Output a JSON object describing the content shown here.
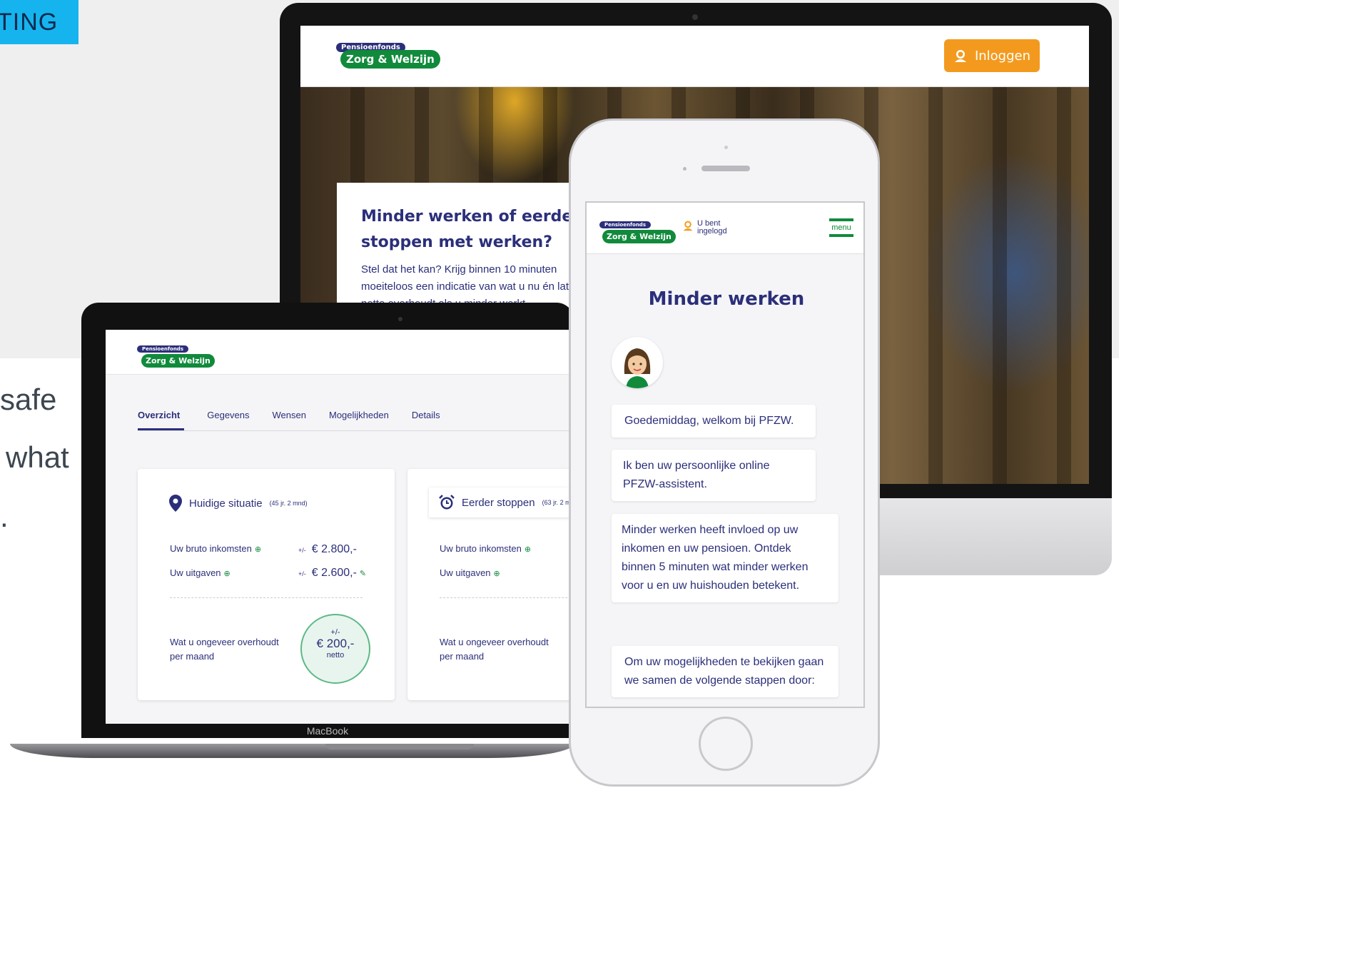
{
  "background": {
    "tag_text": "TING",
    "side_lines": [
      "safe",
      "what",
      "."
    ]
  },
  "brand": {
    "logo_top": "Pensioenfonds",
    "logo_bottom": "Zorg & Welzijn",
    "colors": {
      "navy": "#2b2f7a",
      "green": "#118a3c",
      "orange": "#f39a1e",
      "cyan": "#16b4ee"
    }
  },
  "desktop": {
    "login_label": "Inloggen",
    "login_icon": "user-icon",
    "hero_title": "Minder werken of eerder stoppen met werken?",
    "hero_text": "Stel dat het kan? Krijg binnen 10 minuten moeiteloos een indicatie van wat u nu én later netto overhoudt als u minder werkt"
  },
  "laptop": {
    "brand_label": "MacBook",
    "tabs": [
      "Overzicht",
      "Gegevens",
      "Wensen",
      "Mogelijkheden",
      "Details"
    ],
    "active_tab": "Overzicht",
    "cards": [
      {
        "icon": "location-pin-icon",
        "title": "Huidige situatie",
        "subtitle": "(45 jr. 2 mnd)",
        "income_label": "Uw bruto inkomsten",
        "income_prefix": "+/-",
        "income_value": "€ 2.800,-",
        "expense_label": "Uw uitgaven",
        "expense_prefix": "+/-",
        "expense_value": "€ 2.600,-",
        "net_label": "Wat u ongeveer overhoudt per maand",
        "net_prefix": "+/-",
        "net_value": "€ 200,-",
        "net_suffix": "netto"
      },
      {
        "icon": "alarm-clock-icon",
        "title": "Eerder stoppen",
        "subtitle": "(63 jr. 2 m",
        "income_label": "Uw bruto inkomsten",
        "expense_label": "Uw uitgaven",
        "net_label": "Wat u ongeveer overhoudt per maand"
      }
    ]
  },
  "phone": {
    "logged_in_label": "U bent ingelogd",
    "menu_label": "menu",
    "title": "Minder werken",
    "messages": [
      "Goedemiddag, welkom bij PFZW.",
      "Ik ben uw persoonlijke online PFZW-assistent.",
      "Minder werken heeft invloed op uw inkomen en uw pensioen. Ontdek binnen 5 minuten wat minder werken voor u en uw huishouden betekent.",
      "Om uw mogelijkheden te bekijken gaan we samen de volgende stappen door:"
    ]
  }
}
